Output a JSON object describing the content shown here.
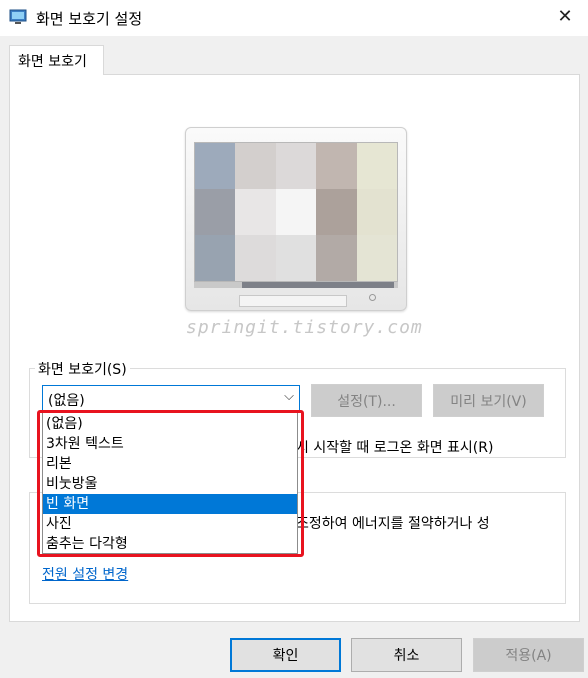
{
  "window": {
    "title": "화면 보호기 설정",
    "close_symbol": "✕",
    "icon": "display-settings-icon"
  },
  "tab": {
    "label": "화면 보호기"
  },
  "preview": {
    "watermark": "springit.tistory.com",
    "tiles": [
      "#9daabb",
      "#d3cfcd",
      "#dcd9d9",
      "#c1b6b0",
      "#e6e6d3",
      "#9a9ea7",
      "#e8e6e6",
      "#f5f5f5",
      "#aca19b",
      "#e3e2d0",
      "#98a3b0",
      "#dddbdb",
      "#e0e0e0",
      "#b2aaa6",
      "#e4e4d4"
    ]
  },
  "screensaver": {
    "group_label": "화면 보호기(S)",
    "selected_value": "(없음)",
    "settings_button": "설정(T)...",
    "preview_button": "미리 보기(V)",
    "resume_text": "시 시작할 때 로그온 화면 표시(R)",
    "options": [
      "(없음)",
      "3차원 텍스트",
      "리본",
      "비눗방울",
      "빈 화면",
      "사진",
      "춤추는 다각형"
    ],
    "highlighted_option": "빈 화면"
  },
  "power": {
    "text": "조정하여 에너지를 절약하거나 성",
    "link": "전원 설정 변경"
  },
  "buttons": {
    "ok": "확인",
    "cancel": "취소",
    "apply": "적용(A)"
  },
  "colors": {
    "accent": "#0078d7",
    "highlight_border": "#e8131f",
    "link": "#0066cc"
  }
}
